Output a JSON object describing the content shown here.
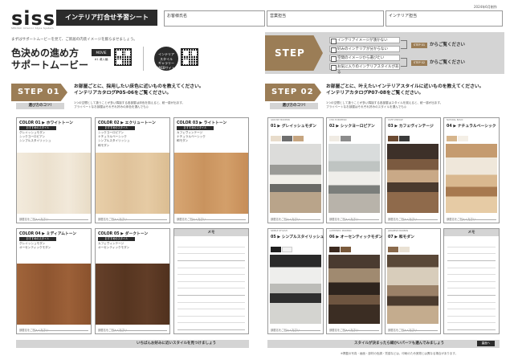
{
  "header": {
    "logo": "siss",
    "logo_sub": "SEKISUI Interior Style System",
    "sheet_title": "インテリア打合せ予習シート",
    "date": "2024年6月制作",
    "fields": [
      "お客様氏名",
      "営業担当",
      "インテリア担当"
    ]
  },
  "intro": {
    "text": "まずはサポートムービーを見て、ご新居の内装イメージを膨らませましょう。",
    "movie_title_1": "色決めの進め方",
    "movie_title_2": "サポートムービー",
    "movie_badge": "MOVIE",
    "movie_badge_sub": "#1 導入編",
    "gallery_1": "インテリア",
    "gallery_2": "スタイル",
    "gallery_3": "ギャラリー",
    "gallery_4": "WEBサイト"
  },
  "step00": {
    "label": "STEP 00",
    "checks": [
      "インテリアイメージが湧かない",
      "好みのインテリアが分からない",
      "空間のイメージから選びたい",
      "お気に入りのインテリアスタイルがある"
    ],
    "go1_tag": "STEP 01",
    "go2_tag": "STEP 02",
    "go_text": "からご覧ください"
  },
  "step01": {
    "label": "STEP 01",
    "desc_1": "お部屋ごとに、採用したい床色に近いものを教えてください。",
    "desc_2": "インテリアカタログP05-06をご覧ください。",
    "desc_3": "1つの空間として扱うことが多い隣接する各部屋は床色を揃えると、統一感が出ます。",
    "desc_4": "プライベートなお部屋はそれぞれ好みの床色を選んでも◎",
    "tip": "選び方のコツ!",
    "style_label": "おすすめのスタイル",
    "foot_label": "部屋名をご記入ください",
    "colors": [
      {
        "num": "COLOR 01",
        "name": "ホワイトトーン",
        "styles": [
          "グレイッシュモダン",
          "シックヨーロピアン",
          "シンプルスタイリッシュ"
        ],
        "hex": "#efe6d6"
      },
      {
        "num": "COLOR 02",
        "name": "エクリュートーン",
        "styles": [
          "シックヨーロピアン",
          "ナチュラルベーシック",
          "シンプルスタイリッシュ",
          "和モダン"
        ],
        "hex": "#e3c9a3"
      },
      {
        "num": "COLOR 03",
        "name": "ライトトーン",
        "styles": [
          "カフェヴィンテージ",
          "ナチュラルベーシック",
          "和モダン"
        ],
        "hex": "#d2a06a"
      },
      {
        "num": "COLOR 04",
        "name": "ミディアムトーン",
        "styles": [
          "グレイッシュモダン",
          "オーセンティックモダン"
        ],
        "hex": "#9a5e35"
      },
      {
        "num": "COLOR 05",
        "name": "ダークトーン",
        "styles": [
          "カフェヴィンテージ",
          "オーセンティックモダン"
        ],
        "hex": "#5e3a22"
      }
    ],
    "memo": "メモ",
    "bottom": "いちばんお好みに近いスタイルを見つけましょう"
  },
  "step02": {
    "label": "STEP 02",
    "desc_1": "お部屋ごとに、叶えたいインテリアスタイルに近いものを教えてください。",
    "desc_2": "インテリアカタログP07-08をご覧ください。",
    "desc_3": "1つの空間として扱うことが多い隣接する各部屋はスタイルを揃えると、統一感が出ます。",
    "desc_4": "プライベートなお部屋はそれぞれ好みのスタイルを選んでも◎",
    "tip": "選び方のコツ!",
    "foot_label": "部屋名をご記入ください",
    "styles": [
      {
        "num": "01",
        "en": "GRAYISH MODERN",
        "name": "グレイッシュモダン"
      },
      {
        "num": "02",
        "en": "CHIC EUROPEAN",
        "name": "シックヨーロピアン"
      },
      {
        "num": "03",
        "en": "CAFE VINTAGE",
        "name": "カフェヴィンテージ"
      },
      {
        "num": "04",
        "en": "NATURAL BASIC",
        "name": "ナチュラルベーシック"
      },
      {
        "num": "05",
        "en": "SIMPLE STYLISH",
        "name": "シンプルスタイリッシュ"
      },
      {
        "num": "06",
        "en": "AUTHENTIC MODERN",
        "name": "オーセンティックモダン"
      },
      {
        "num": "07",
        "en": "JAPANESE MODERN",
        "name": "和モダン"
      }
    ],
    "memo": "メモ",
    "bottom": "スタイルが決まったら細かいパーツも選んでみましょう",
    "bottom_tag": "裏面へ",
    "note": "※掲載の写真・画面・部材の色調・質感などは、印刷のため実物とは異なる場合があります。"
  },
  "colors": {
    "accent": "#9b7d56",
    "dark": "#2b2b2b",
    "gray": "#d4d4d4"
  }
}
